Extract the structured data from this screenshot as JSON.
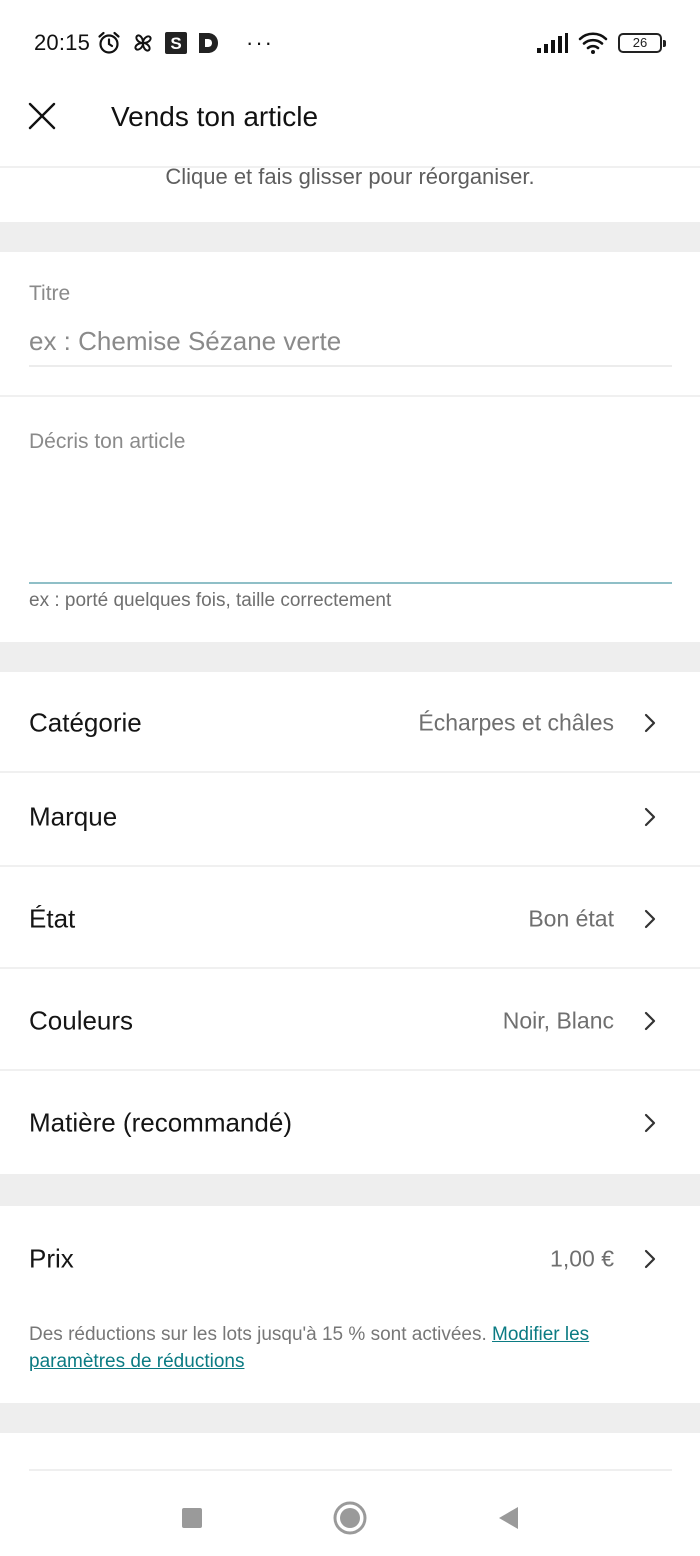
{
  "status_bar": {
    "time": "20:15",
    "battery": "26",
    "more": "···",
    "icons": [
      "alarm-icon",
      "pinwheel-icon",
      "s-app-icon",
      "d-app-icon",
      "signal-icon",
      "wifi-icon",
      "battery-icon"
    ]
  },
  "header": {
    "title": "Vends ton article",
    "close_icon": "close-icon"
  },
  "photos": {
    "hint": "Clique et fais glisser pour réorganiser."
  },
  "title_field": {
    "label": "Titre",
    "placeholder": "ex : Chemise Sézane verte"
  },
  "description_field": {
    "label": "Décris ton article",
    "helper": "ex : porté quelques fois, taille correctement"
  },
  "details": {
    "rows": [
      {
        "label": "Catégorie",
        "value": "Écharpes et châles"
      },
      {
        "label": "Marque",
        "value": ""
      },
      {
        "label": "État",
        "value": "Bon état"
      },
      {
        "label": "Couleurs",
        "value": "Noir, Blanc"
      },
      {
        "label": "Matière (recommandé)",
        "value": ""
      }
    ]
  },
  "price": {
    "label": "Prix",
    "value": "1,00 €",
    "note": "Des réductions sur les lots jusqu'à 15 % sont activées. ",
    "link": "Modifier les paramètres de réductions"
  },
  "colors": {
    "accent": "#0b7b83",
    "section_gap": "#eeeeee",
    "muted_text": "#6f6f6f"
  }
}
